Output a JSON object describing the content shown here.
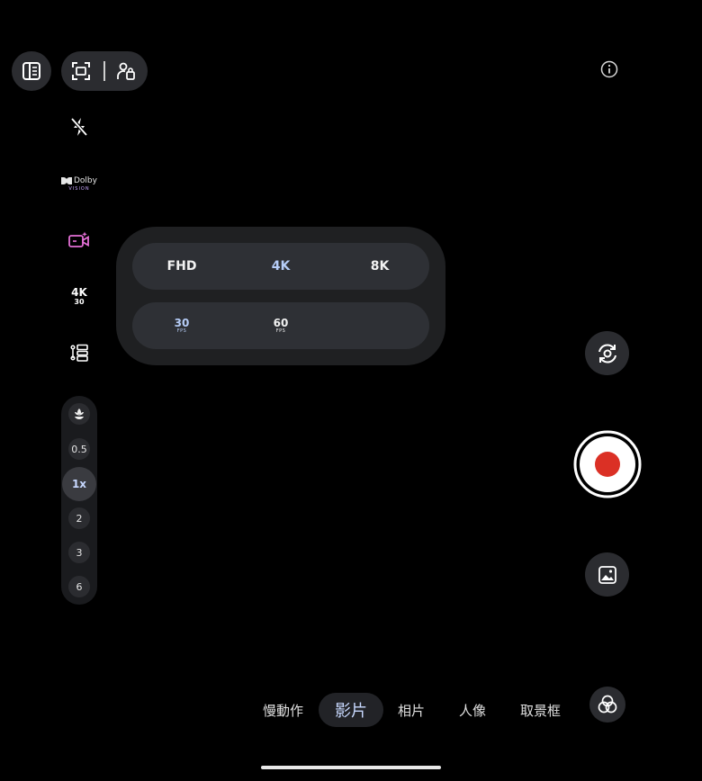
{
  "sidebar": {
    "dolby_line1": "Dolby",
    "dolby_line2": "VISION",
    "resolution_badge": "4K",
    "framerate_badge": "30"
  },
  "zoom": {
    "levels": [
      "0.5",
      "1x",
      "2",
      "3",
      "6"
    ],
    "selected": "1x"
  },
  "video_settings": {
    "resolutions": [
      "FHD",
      "4K",
      "8K"
    ],
    "selected_resolution": "4K",
    "frame_rates": [
      {
        "value": "30",
        "unit": "FPS"
      },
      {
        "value": "60",
        "unit": "FPS"
      }
    ],
    "selected_frame_rate": "30"
  },
  "modes": {
    "items": [
      "慢動作",
      "影片",
      "相片",
      "人像",
      "取景框"
    ],
    "selected": "影片"
  },
  "colors": {
    "record_red": "#db3025",
    "accent_blue": "#b6cdf8",
    "control_bg": "#2b2c30",
    "dolby_purple": "#c9a7ff",
    "effects_pink": "#e36fd5"
  },
  "icons": {
    "top_left": "panel-layout-icon",
    "top_group": [
      "fullscreen-frame-icon",
      "person-lock-icon"
    ],
    "top_right": "info-icon",
    "side": [
      "flash-off-icon",
      "dolby-vision-icon",
      "video-effects-icon",
      "resolution-badge",
      "settings-list-icon"
    ],
    "macro": "macro-flower-icon",
    "right": [
      "switch-camera-icon",
      "record-button",
      "gallery-icon",
      "filters-icon"
    ]
  }
}
